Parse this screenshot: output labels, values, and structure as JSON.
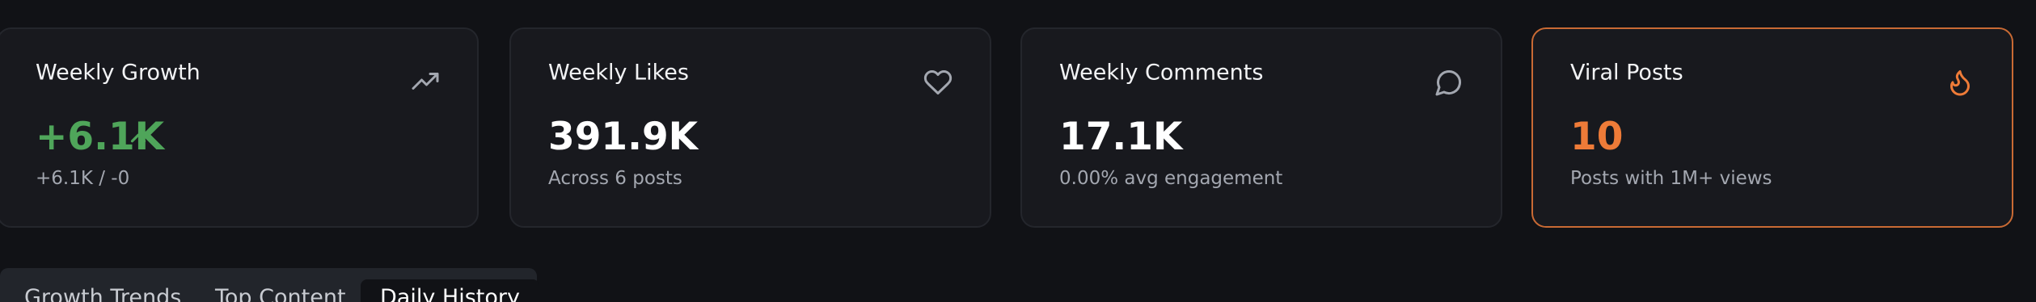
{
  "cards": [
    {
      "title": "Weekly Growth",
      "value": "+6.1K",
      "subtitle": "+6.1K / -0",
      "icon": "trending-up-icon",
      "value_color": "#4fa55a"
    },
    {
      "title": "Weekly Likes",
      "value": "391.9K",
      "subtitle": "Across 6 posts",
      "icon": "heart-icon"
    },
    {
      "title": "Weekly Comments",
      "value": "17.1K",
      "subtitle": "0.00% avg engagement",
      "icon": "message-circle-icon"
    },
    {
      "title": "Viral Posts",
      "value": "10",
      "subtitle": "Posts with 1M+ views",
      "icon": "flame-icon",
      "value_color": "#ee7b38",
      "border_color": "#c96a34"
    }
  ],
  "tabs": [
    {
      "label": "Growth Trends",
      "active": false
    },
    {
      "label": "Top Content",
      "active": false
    },
    {
      "label": "Daily History",
      "active": true
    }
  ],
  "colors": {
    "background": "#111216",
    "card": "#18191e",
    "accent_green": "#4fa55a",
    "accent_orange": "#ee7b38"
  }
}
